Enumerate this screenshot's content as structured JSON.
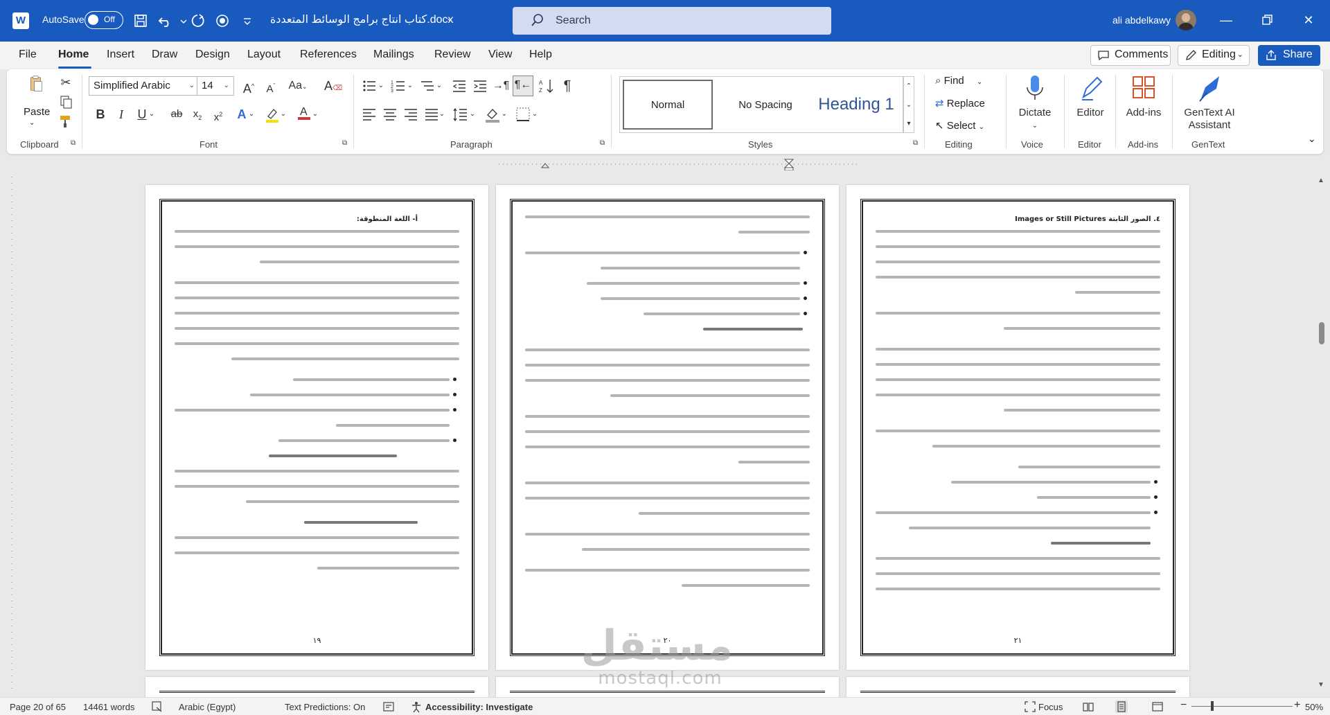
{
  "app": {
    "autosave_label": "AutoSave",
    "autosave_state": "Off",
    "document_title": "كتاب انتاج برامج الوسائط المتعددة.docx",
    "search_placeholder": "Search",
    "user_name": "ali abdelkawy",
    "accent_color": "#185abd"
  },
  "tabs": [
    "File",
    "Home",
    "Insert",
    "Draw",
    "Design",
    "Layout",
    "References",
    "Mailings",
    "Review",
    "View",
    "Help"
  ],
  "active_tab": "Home",
  "right_buttons": {
    "comments": "Comments",
    "editing": "Editing",
    "share": "Share"
  },
  "ribbon": {
    "clipboard": {
      "label": "Clipboard",
      "paste": "Paste"
    },
    "font": {
      "label": "Font",
      "font_name": "Simplified Arabic",
      "font_size": "14"
    },
    "paragraph": {
      "label": "Paragraph"
    },
    "styles": {
      "label": "Styles",
      "items": [
        "Normal",
        "No Spacing",
        "Heading 1"
      ]
    },
    "editing": {
      "label": "Editing",
      "find": "Find",
      "replace": "Replace",
      "select": "Select"
    },
    "voice": {
      "label": "Voice",
      "dictate": "Dictate"
    },
    "editor": {
      "label": "Editor",
      "editor": "Editor"
    },
    "addins": {
      "label": "Add-ins",
      "addins": "Add-ins"
    },
    "gentext": {
      "label": "GenText",
      "button": "GenText AI Assistant"
    }
  },
  "pages": [
    {
      "number": "١٩",
      "heading_ar": "أ- اللغة المنطوقة:",
      "heading_en": ""
    },
    {
      "number": "٢٠",
      "heading_ar": "",
      "heading_en": ""
    },
    {
      "number": "٢١",
      "heading_ar": "٤. الصور الثابتة",
      "heading_en": "Images or Still Pictures"
    }
  ],
  "watermark": {
    "arabic": "مستقل",
    "latin": "mostaql.com"
  },
  "status": {
    "page": "Page 20 of 65",
    "words": "14461 words",
    "language": "Arabic (Egypt)",
    "text_predictions": "Text Predictions: On",
    "accessibility": "Accessibility: Investigate",
    "focus": "Focus",
    "zoom": "50%"
  }
}
